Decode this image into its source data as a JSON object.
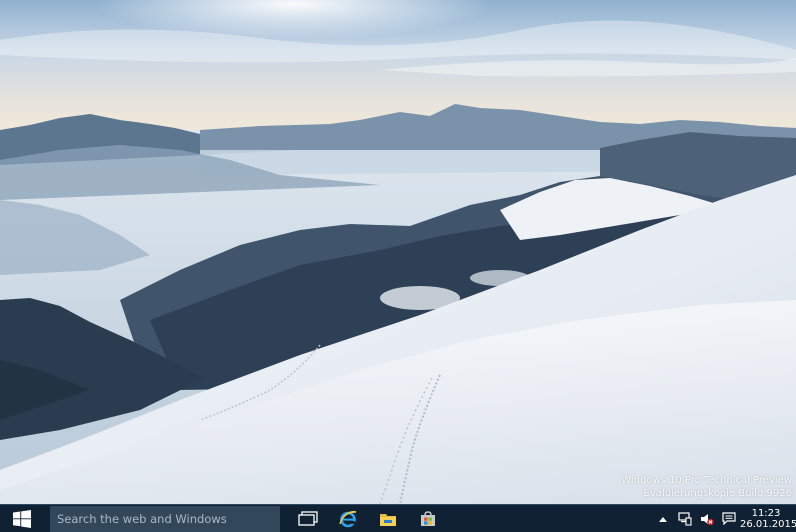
{
  "desktop": {
    "wallpaper": "snowy-mountain-landscape",
    "watermark": {
      "line1": "Windows 10 Pro Technical Preview",
      "line2": "Evaluierungskopie Build 9926"
    }
  },
  "taskbar": {
    "background_color": "#0f2133",
    "start_icon": "windows-logo-icon",
    "search_placeholder": "Search the web and Windows",
    "apps": [
      {
        "name": "Task View",
        "icon": "task-view-icon"
      },
      {
        "name": "Internet Explorer",
        "icon": "internet-explorer-icon"
      },
      {
        "name": "File Explorer",
        "icon": "file-explorer-icon"
      },
      {
        "name": "Store",
        "icon": "store-icon"
      }
    ],
    "tray": {
      "icons": [
        "show-hidden-icons-chevron",
        "network-icon",
        "volume-muted-icon",
        "action-center-icon"
      ],
      "time": "11:23",
      "date": "26.01.2015"
    }
  }
}
